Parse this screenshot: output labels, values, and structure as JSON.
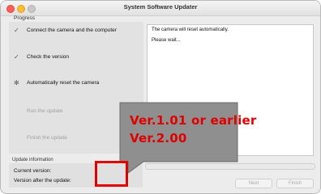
{
  "window": {
    "title": "System Software Updater"
  },
  "progress": {
    "label": "Progress",
    "steps": [
      {
        "icon": "checkmark-icon",
        "label": "Connect the camera and the computer",
        "state": "done"
      },
      {
        "icon": "checkmark-icon",
        "label": "Check the version",
        "state": "done"
      },
      {
        "icon": "spinner-icon",
        "label": "Automatically reset the camera",
        "state": "active"
      },
      {
        "icon": "",
        "label": "Run the update",
        "state": "pending"
      },
      {
        "icon": "",
        "label": "Finish the update",
        "state": "pending"
      }
    ]
  },
  "message": {
    "lines": [
      "The camera will reset automatically.",
      "Please wait..."
    ]
  },
  "update_info": {
    "label": "Update information",
    "current_version_label": "Current version:",
    "after_update_label": "Version after the update:"
  },
  "buttons": {
    "next": "Next",
    "finish": "Finish"
  },
  "callout": {
    "line1": "Ver.1.01 or earlier",
    "line2": "Ver.2.00",
    "accent": "#e00000"
  }
}
